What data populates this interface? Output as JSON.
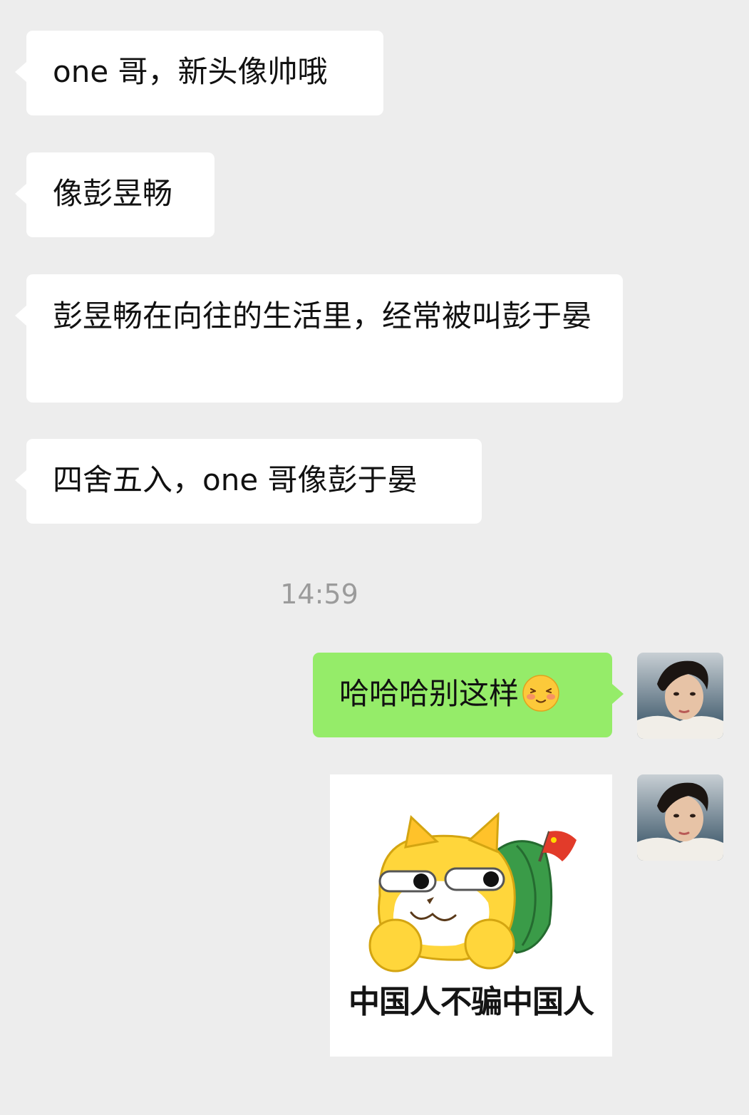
{
  "messages_incoming": [
    {
      "text": "one 哥，新头像帅哦"
    },
    {
      "text": "像彭昱畅"
    },
    {
      "text": "彭昱畅在向往的生活里，经常被叫彭于晏"
    },
    {
      "text": "四舍五入，one 哥像彭于晏"
    }
  ],
  "timestamp": "14:59",
  "messages_outgoing": [
    {
      "text": "哈哈哈别这样",
      "emoji": "blush-smile-emoji"
    }
  ],
  "sticker": {
    "caption": "中国人不骗中国人",
    "icon": "shiba-backpack-flag-sticker"
  },
  "colors": {
    "background": "#ededed",
    "incoming_bubble": "#ffffff",
    "outgoing_bubble": "#95ec69",
    "timestamp_text": "#9b9b9b"
  }
}
